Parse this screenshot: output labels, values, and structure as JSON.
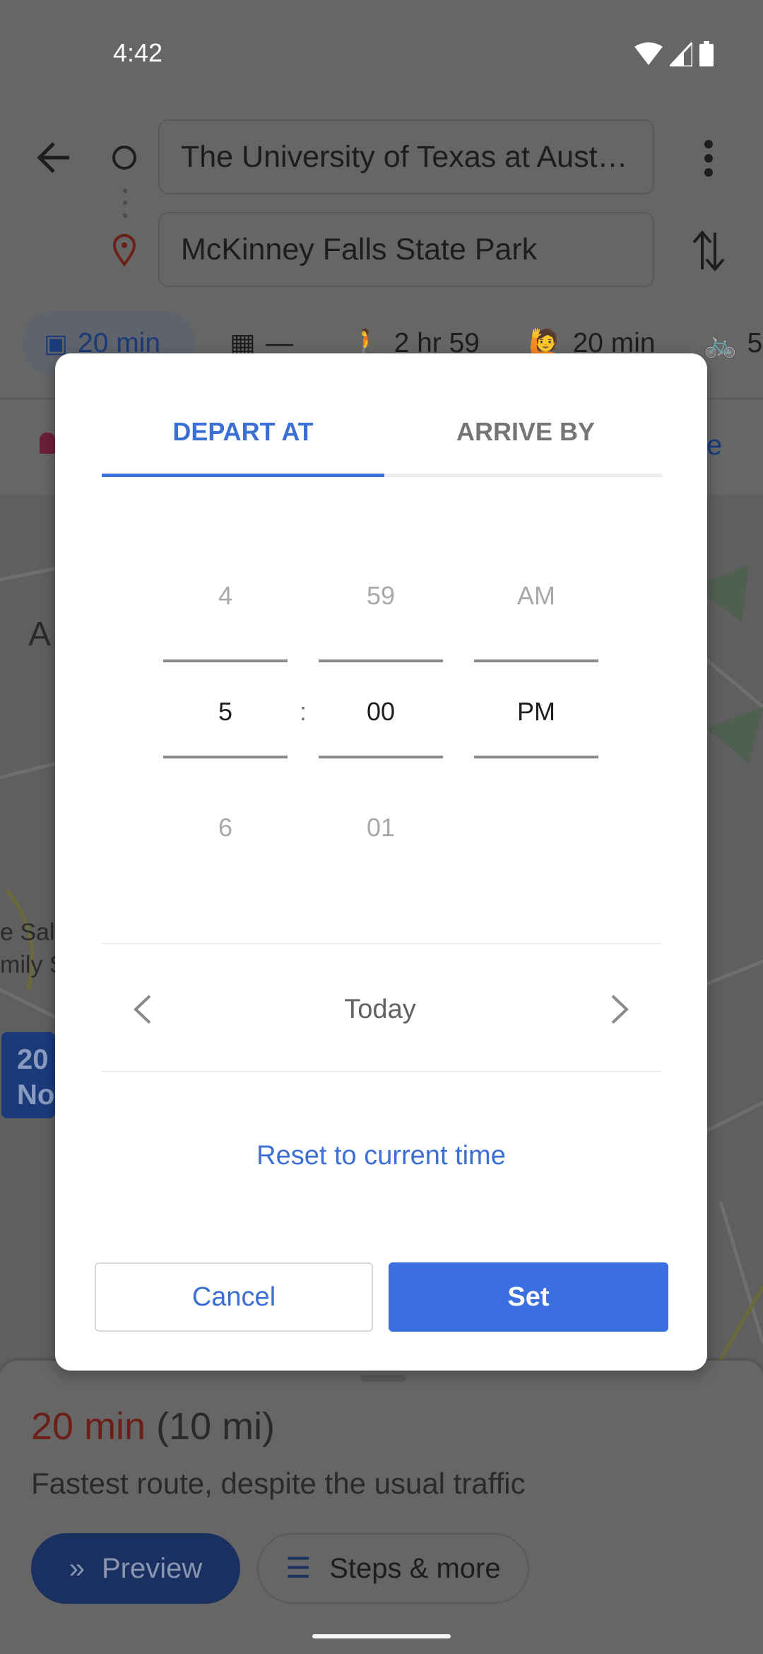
{
  "status_bar": {
    "time": "4:42"
  },
  "directions": {
    "origin": "The University of Texas at Aust…",
    "destination": "McKinney Falls State Park"
  },
  "modes": [
    {
      "icon": "car-icon",
      "label": "20 min"
    },
    {
      "icon": "transit-icon",
      "label": "—"
    },
    {
      "icon": "walk-icon",
      "label": "2 hr 59"
    },
    {
      "icon": "rideshare-icon",
      "label": "20 min"
    },
    {
      "icon": "bike-icon",
      "label": "5"
    }
  ],
  "map": {
    "labels": [
      "A",
      "e Salv",
      "mily S"
    ],
    "badge": [
      "20",
      "No"
    ],
    "partial_link": "e"
  },
  "dialog": {
    "tabs": [
      {
        "label": "DEPART AT",
        "active": true
      },
      {
        "label": "ARRIVE BY",
        "active": false
      }
    ],
    "hour": {
      "prev": "4",
      "value": "5",
      "next": "6"
    },
    "separator": ":",
    "minute": {
      "prev": "59",
      "value": "00",
      "next": "01"
    },
    "ampm": {
      "prev": "AM",
      "value": "PM"
    },
    "day": "Today",
    "reset": "Reset to current time",
    "cancel": "Cancel",
    "set": "Set",
    "accent": "#3b6fd4"
  },
  "route": {
    "duration": "20 min",
    "distance": "(10 mi)",
    "summary": "Fastest route, despite the usual traffic",
    "preview": "Preview",
    "steps": "Steps & more"
  }
}
